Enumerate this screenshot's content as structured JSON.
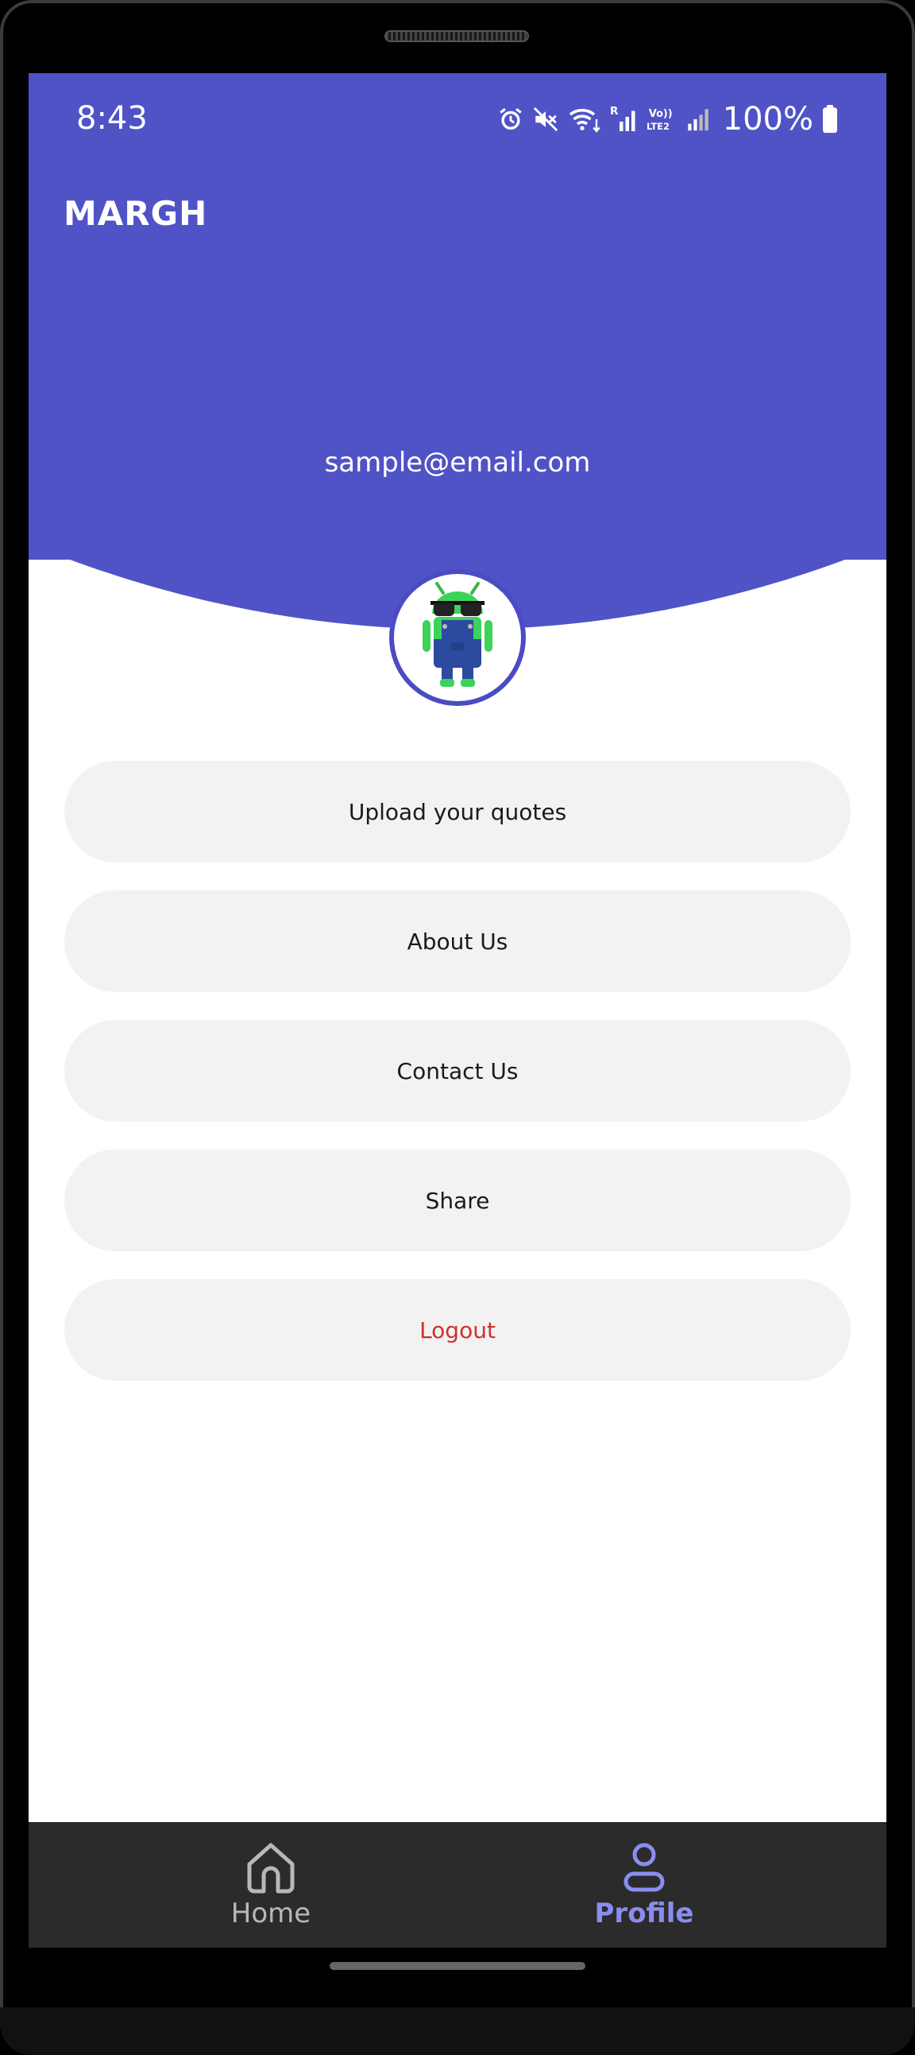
{
  "status_bar": {
    "time": "8:43",
    "battery": "100%",
    "icons": [
      "alarm-icon",
      "mute-icon",
      "wifi-icon",
      "signal-icon",
      "volte-icon",
      "signal-weak-icon",
      "battery-icon"
    ]
  },
  "app": {
    "title": "MARGH",
    "email": "sample@email.com",
    "avatar": "android-avatar"
  },
  "menu": [
    {
      "label": "Upload your quotes"
    },
    {
      "label": "About Us"
    },
    {
      "label": "Contact Us"
    },
    {
      "label": "Share"
    },
    {
      "label": "Logout"
    }
  ],
  "bottom_nav": {
    "items": [
      {
        "label": "Home",
        "icon": "home-icon",
        "active": false
      },
      {
        "label": "Profile",
        "icon": "person-icon",
        "active": true
      }
    ]
  },
  "colors": {
    "primary": "#5053c6",
    "active_nav": "#8a8df0",
    "logout": "#d32f2f",
    "button_bg": "#f2f2f2",
    "nav_bg": "#2b2b2b"
  }
}
